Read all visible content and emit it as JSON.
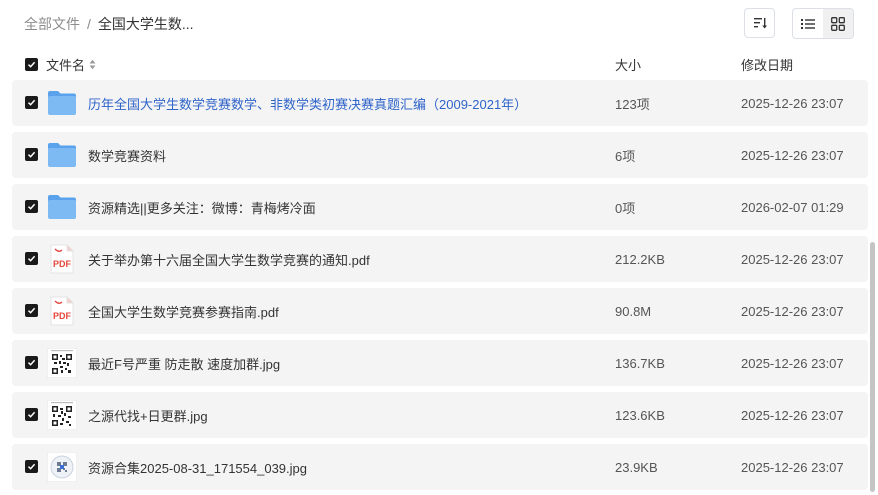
{
  "breadcrumb": {
    "root": "全部文件",
    "separator": "/",
    "current": "全国大学生数..."
  },
  "toolbar": {
    "sort_icon": "sort-icon",
    "list_view_icon": "list-view-icon",
    "grid_view_icon": "grid-view-icon"
  },
  "header": {
    "name": "文件名",
    "size": "大小",
    "date": "修改日期"
  },
  "files": [
    {
      "name": "历年全国大学生数学竞赛数学、非数学类初赛决赛真题汇编（2009-2021年）",
      "size": "123项",
      "date": "2025-12-26 23:07",
      "type": "folder",
      "icon": "folder-icon"
    },
    {
      "name": "数学竞赛资料",
      "size": "6项",
      "date": "2025-12-26 23:07",
      "type": "folder",
      "icon": "folder-icon"
    },
    {
      "name": "资源精选||更多关注：微博：青梅烤冷面",
      "size": "0项",
      "date": "2026-02-07 01:29",
      "type": "folder",
      "icon": "folder-icon"
    },
    {
      "name": "关于举办第十六届全国大学生数学竞赛的通知.pdf",
      "size": "212.2KB",
      "date": "2025-12-26 23:07",
      "type": "pdf",
      "icon": "pdf-icon",
      "icon_label": "PDF"
    },
    {
      "name": "全国大学生数学竞赛参赛指南.pdf",
      "size": "90.8M",
      "date": "2025-12-26 23:07",
      "type": "pdf",
      "icon": "pdf-icon",
      "icon_label": "PDF"
    },
    {
      "name": "最近F号严重 防走散 速度加群.jpg",
      "size": "136.7KB",
      "date": "2025-12-26 23:07",
      "type": "image",
      "icon": "qr-code-thumbnail"
    },
    {
      "name": "之源代找+日更群.jpg",
      "size": "123.6KB",
      "date": "2025-12-26 23:07",
      "type": "image",
      "icon": "qr-code-thumbnail"
    },
    {
      "name": "资源合集2025-08-31_171554_039.jpg",
      "size": "23.9KB",
      "date": "2025-12-26 23:07",
      "type": "image",
      "icon": "qr-code-thumbnail"
    }
  ],
  "colors": {
    "link": "#2f64c9",
    "row_bg": "#f4f4f5",
    "folder": "#79b8f3",
    "pdf": "#e5453a"
  }
}
